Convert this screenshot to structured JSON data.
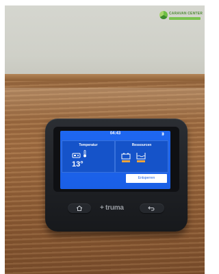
{
  "watermark": {
    "text": "CARAVAN CENTER",
    "icon": "leaf-logo-icon"
  },
  "device": {
    "brand": "truma",
    "brand_mark": "+",
    "status_bar": {
      "time": "04:43",
      "bluetooth_icon": "bluetooth-icon"
    },
    "tiles": {
      "temperature": {
        "title": "Temperatur",
        "value": "13°",
        "icons": [
          "heater-icon",
          "thermometer-icon"
        ]
      },
      "resources": {
        "title": "Ressourcen",
        "icons": [
          "battery-icon",
          "water-tank-icon"
        ]
      }
    },
    "unlock_button": "Entsperren",
    "buttons": {
      "home_icon": "home-icon",
      "back_icon": "back-arrow-icon"
    },
    "colors": {
      "screen_blue": "#1a5fe6",
      "tile_blue": "#1553c9",
      "level_orange": "#f0a43a"
    }
  }
}
